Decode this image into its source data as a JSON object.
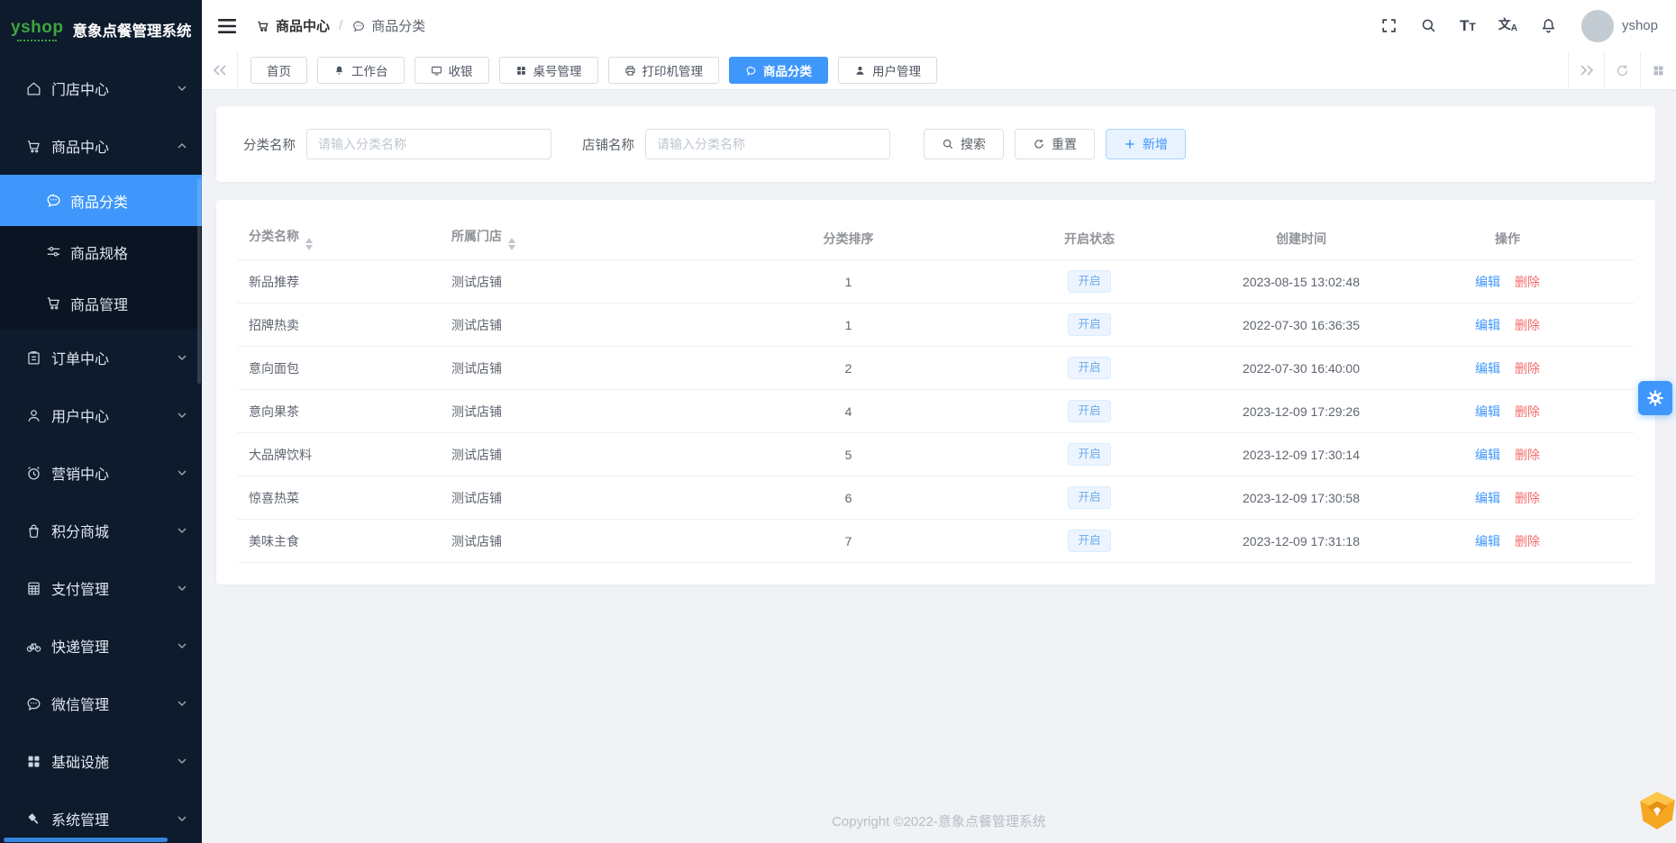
{
  "app": {
    "logo_text": "yshop",
    "title": "意象点餐管理系统"
  },
  "header": {
    "breadcrumb": {
      "section": "商品中心",
      "separator": "/",
      "page": "商品分类"
    },
    "user_name": "yshop"
  },
  "tabbar": {
    "tabs": [
      {
        "label": "首页",
        "icon": "none",
        "active": false
      },
      {
        "label": "工作台",
        "icon": "bell-icon",
        "active": false
      },
      {
        "label": "收银",
        "icon": "monitor-icon",
        "active": false
      },
      {
        "label": "桌号管理",
        "icon": "grid-icon",
        "active": false
      },
      {
        "label": "打印机管理",
        "icon": "printer-icon",
        "active": false
      },
      {
        "label": "商品分类",
        "icon": "comment-icon",
        "active": true
      },
      {
        "label": "用户管理",
        "icon": "user-icon",
        "active": false
      }
    ]
  },
  "sidebar": {
    "items": [
      {
        "label": "门店中心",
        "icon": "home-icon",
        "expanded": false
      },
      {
        "label": "商品中心",
        "icon": "cart-icon",
        "expanded": true,
        "children": [
          {
            "label": "商品分类",
            "icon": "comment-icon",
            "active": true
          },
          {
            "label": "商品规格",
            "icon": "sliders-icon",
            "active": false
          },
          {
            "label": "商品管理",
            "icon": "cart-icon",
            "active": false
          }
        ]
      },
      {
        "label": "订单中心",
        "icon": "order-icon",
        "expanded": false
      },
      {
        "label": "用户中心",
        "icon": "user-icon",
        "expanded": false
      },
      {
        "label": "营销中心",
        "icon": "alarm-icon",
        "expanded": false
      },
      {
        "label": "积分商城",
        "icon": "bag-icon",
        "expanded": false
      },
      {
        "label": "支付管理",
        "icon": "calculator-icon",
        "expanded": false
      },
      {
        "label": "快递管理",
        "icon": "bicycle-icon",
        "expanded": false
      },
      {
        "label": "微信管理",
        "icon": "wechat-icon",
        "expanded": false
      },
      {
        "label": "基础设施",
        "icon": "blocks-icon",
        "expanded": false
      },
      {
        "label": "系统管理",
        "icon": "gavel-icon",
        "expanded": false
      }
    ]
  },
  "filter": {
    "category_label": "分类名称",
    "category_placeholder": "请输入分类名称",
    "category_value": "",
    "shop_label": "店铺名称",
    "shop_placeholder": "请输入分类名称",
    "shop_value": "",
    "search_button": "搜索",
    "reset_button": "重置",
    "add_button": "新增"
  },
  "table": {
    "columns": [
      {
        "label": "分类名称",
        "sortable": true
      },
      {
        "label": "所属门店",
        "sortable": true
      },
      {
        "label": "分类排序",
        "sortable": false
      },
      {
        "label": "开启状态",
        "sortable": false
      },
      {
        "label": "创建时间",
        "sortable": false
      },
      {
        "label": "操作",
        "sortable": false
      }
    ],
    "edit_label": "编辑",
    "delete_label": "删除",
    "rows": [
      {
        "name": "新品推荐",
        "shop": "测试店铺",
        "sort": "1",
        "status": "开启",
        "created": "2023-08-15 13:02:48"
      },
      {
        "name": "招牌热卖",
        "shop": "测试店铺",
        "sort": "1",
        "status": "开启",
        "created": "2022-07-30 16:36:35"
      },
      {
        "name": "意向面包",
        "shop": "测试店铺",
        "sort": "2",
        "status": "开启",
        "created": "2022-07-30 16:40:00"
      },
      {
        "name": "意向果茶",
        "shop": "测试店铺",
        "sort": "4",
        "status": "开启",
        "created": "2023-12-09 17:29:26"
      },
      {
        "name": "大品牌饮料",
        "shop": "测试店铺",
        "sort": "5",
        "status": "开启",
        "created": "2023-12-09 17:30:14"
      },
      {
        "name": "惊喜热菜",
        "shop": "测试店铺",
        "sort": "6",
        "status": "开启",
        "created": "2023-12-09 17:30:58"
      },
      {
        "name": "美味主食",
        "shop": "测试店铺",
        "sort": "7",
        "status": "开启",
        "created": "2023-12-09 17:31:18"
      }
    ]
  },
  "footer": {
    "copyright": "Copyright ©2022-意象点餐管理系统"
  },
  "colors": {
    "accent": "#3f97fb",
    "danger": "#f56c6c",
    "sidebar_bg": "#0d1b2d",
    "submenu_bg": "#0a1422",
    "tag_bg": "#ecf5ff",
    "tag_text": "#6ca9e8",
    "logo_green": "#3ea43f",
    "content_bg": "#f0f2f5"
  }
}
